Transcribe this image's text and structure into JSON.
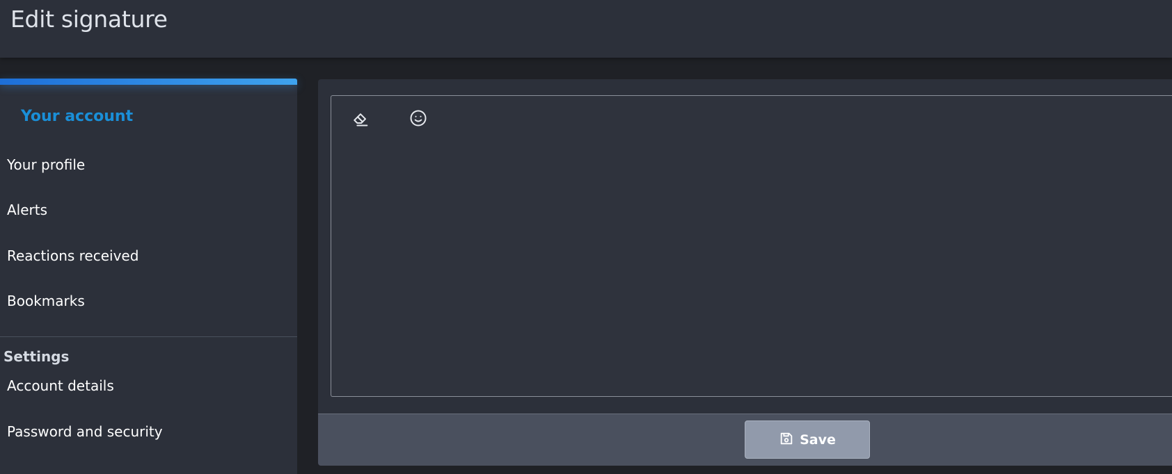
{
  "header": {
    "title": "Edit signature"
  },
  "sidebar": {
    "heading": "Your account",
    "items": [
      {
        "label": "Your profile"
      },
      {
        "label": "Alerts"
      },
      {
        "label": "Reactions received"
      },
      {
        "label": "Bookmarks"
      }
    ],
    "settings_title": "Settings",
    "settings_items": [
      {
        "label": "Account details"
      },
      {
        "label": "Password and security"
      }
    ]
  },
  "editor": {
    "toolbar": [
      {
        "icon": "eraser-icon",
        "name": "remove-formatting"
      },
      {
        "icon": "smile-icon",
        "name": "insert-emoji"
      }
    ],
    "content": ""
  },
  "footer": {
    "save_label": "Save",
    "save_icon": "floppy-disk-icon"
  },
  "colors": {
    "accent": "#1a8fd8",
    "panel": "#2c303a",
    "background": "#1f2126",
    "button": "#919aab"
  }
}
